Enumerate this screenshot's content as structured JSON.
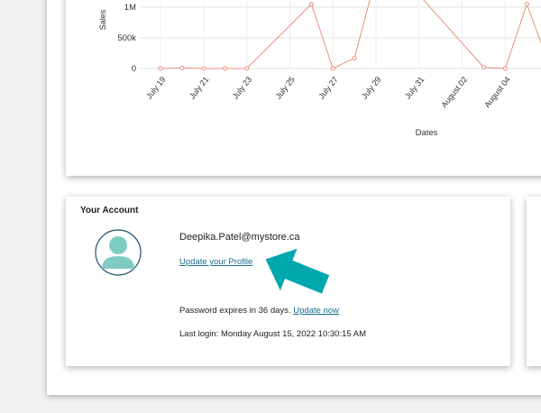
{
  "chart_data": {
    "type": "line",
    "xlabel": "Dates",
    "ylabel": "Sales",
    "y_ticks": [
      "0",
      "500k",
      "1M"
    ],
    "x_ticks": [
      "July 19",
      "July 21",
      "July 23",
      "July 25",
      "July 27",
      "July 29",
      "July 31",
      "August 02",
      "August 04"
    ],
    "line_color": "#e8907f",
    "points": [
      {
        "d": 0,
        "v": 0
      },
      {
        "d": 1,
        "v": 10000
      },
      {
        "d": 2,
        "v": 0
      },
      {
        "d": 3,
        "v": 0
      },
      {
        "d": 4,
        "v": 0
      },
      {
        "d": 7,
        "v": 1050000
      },
      {
        "d": 8,
        "v": 0
      },
      {
        "d": 9,
        "v": 170000
      },
      {
        "d": 10,
        "v": 1500000
      },
      {
        "d": 12,
        "v": 1200000
      },
      {
        "d": 15,
        "v": 20000
      },
      {
        "d": 16,
        "v": 0
      },
      {
        "d": 17,
        "v": 1050000
      },
      {
        "d": 18,
        "v": 100000
      }
    ]
  },
  "account": {
    "title": "Your Account",
    "email": "Deepika.Patel@mystore.ca",
    "update_profile": "Update your Profile",
    "password_text": "Password expires in 36 days.",
    "update_now": "Update now",
    "last_login": "Last login: Monday August 15, 2022 10:30:15 AM",
    "avatar_color": "#7ecbc4",
    "avatar_ring": "#1f4f6e",
    "arrow_color": "#00a7ad"
  }
}
